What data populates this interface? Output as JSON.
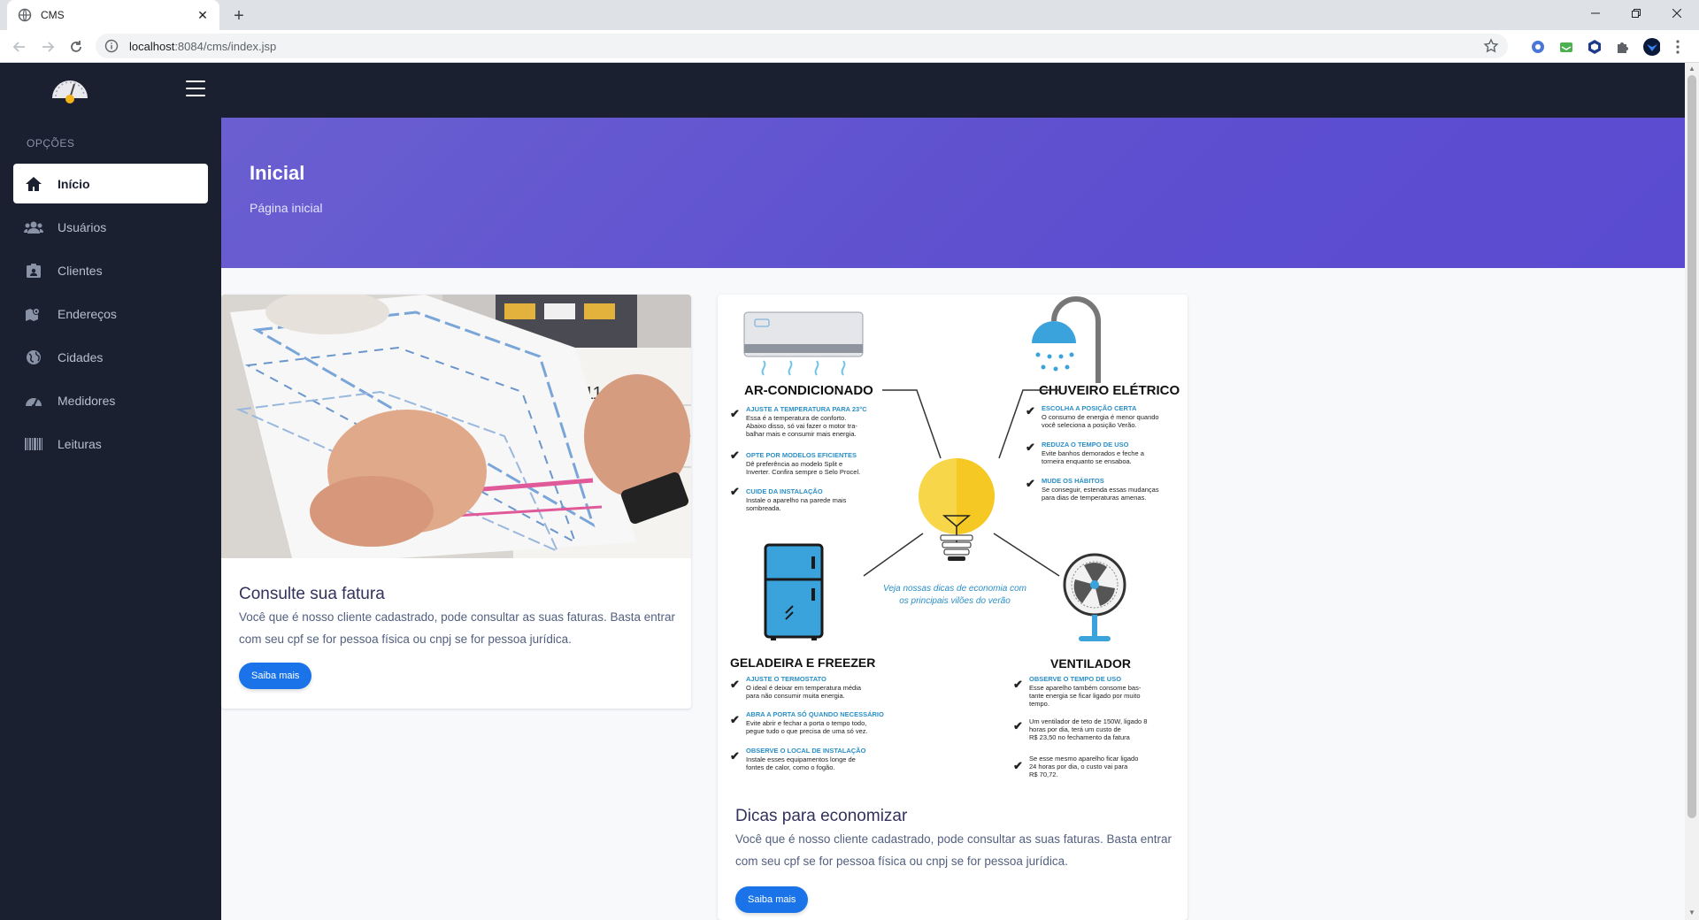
{
  "browser": {
    "tab_title": "CMS",
    "url_host": "localhost",
    "url_rest": ":8084/cms/index.jsp"
  },
  "sidebar": {
    "section_label": "OPÇÕES",
    "items": [
      {
        "label": "Início",
        "icon": "home-icon"
      },
      {
        "label": "Usuários",
        "icon": "users-icon"
      },
      {
        "label": "Clientes",
        "icon": "id-card-icon"
      },
      {
        "label": "Endereços",
        "icon": "map-marker-icon"
      },
      {
        "label": "Cidades",
        "icon": "globe-icon"
      },
      {
        "label": "Medidores",
        "icon": "gauge-icon"
      },
      {
        "label": "Leituras",
        "icon": "barcode-icon"
      }
    ]
  },
  "header": {
    "title": "Inicial",
    "subtitle": "Página inicial"
  },
  "cards": [
    {
      "title": "Consulte sua fatura",
      "text": "Você que é nosso cliente cadastrado, pode consultar as suas faturas. Basta entrar com seu cpf se for pessoa física ou cnpj se for pessoa jurídica.",
      "button": "Saiba mais"
    },
    {
      "title": "Dicas para economizar",
      "text": "Você que é nosso cliente cadastrado, pode consultar as suas faturas. Basta entrar com seu cpf se for pessoa física ou cnpj se for pessoa jurídica.",
      "button": "Saiba mais"
    }
  ],
  "infographic": {
    "ac_title": "AR-CONDICIONADO",
    "ac_tip1_head": "AJUSTE A TEMPERATURA PARA 23°C",
    "ac_tip1_l1": "Essa é a temperatura de conforto.",
    "ac_tip1_l2": "Abaixo disso, só vai fazer o motor tra-",
    "ac_tip1_l3": "balhar mais e consumir mais energia.",
    "ac_tip2_head": "OPTE POR MODELOS EFICIENTES",
    "ac_tip2_l1": "Dê preferência ao modelo Split e",
    "ac_tip2_l2": "Inverter. Confira sempre o Selo Procel.",
    "ac_tip3_head": "CUIDE DA INSTALAÇÃO",
    "ac_tip3_l1": "Instale o aparelho na parede mais",
    "ac_tip3_l2": "sombreada.",
    "shower_title": "CHUVEIRO ELÉTRICO",
    "shower_tip1_head": "ESCOLHA A POSIÇÃO CERTA",
    "shower_tip1_l1": "O consumo de energia é menor quando",
    "shower_tip1_l2": "você seleciona a posição Verão.",
    "shower_tip2_head": "REDUZA O TEMPO DE USO",
    "shower_tip2_l1": "Evite banhos demorados e feche a",
    "shower_tip2_l2": "torneira enquanto se ensaboa.",
    "shower_tip3_head": "MUDE OS HÁBITOS",
    "shower_tip3_l1": "Se conseguir, estenda essas mudanças",
    "shower_tip3_l2": "para dias de temperaturas amenas.",
    "center_l1": "Veja nossas dicas de economia com",
    "center_l2": "os principais vilões do verão",
    "fridge_title": "GELADEIRA E FREEZER",
    "fridge_tip1_head": "AJUSTE O TERMOSTATO",
    "fridge_tip1_l1": "O ideal é deixar em temperatura média",
    "fridge_tip1_l2": "para não consumir muita energia.",
    "fridge_tip2_head": "ABRA A PORTA SÓ QUANDO NECESSÁRIO",
    "fridge_tip2_l1": "Evite abrir e fechar a porta o tempo todo,",
    "fridge_tip2_l2": "pegue tudo o que precisa de uma só vez.",
    "fridge_tip3_head": "OBSERVE O LOCAL DE INSTALAÇÃO",
    "fridge_tip3_l1": "Instale esses equipamentos longe de",
    "fridge_tip3_l2": "fontes de calor, como o fogão.",
    "fan_title": "VENTILADOR",
    "fan_tip1_head": "OBSERVE O TEMPO DE USO",
    "fan_tip1_l1": "Esse aparelho também consome bas-",
    "fan_tip1_l2": "tante energia se ficar ligado por muito",
    "fan_tip1_l3": "tempo.",
    "fan_tip2_l1": "Um ventilador de teto de 150W, ligado 8",
    "fan_tip2_l2": "horas por dia, terá um custo de",
    "fan_tip2_l3": "R$ 23,50 no fechamento da fatura",
    "fan_tip3_l1": "Se esse mesmo aparelho ficar ligado",
    "fan_tip3_l2": "24 horas por dia, o custo vai para",
    "fan_tip3_l3": "R$ 70,72."
  },
  "photo": {
    "calendar_day": "11"
  },
  "colors": {
    "sidebar_bg": "#1b2030",
    "header_gradient": "#6a5fd0",
    "button": "#1a73e8"
  }
}
